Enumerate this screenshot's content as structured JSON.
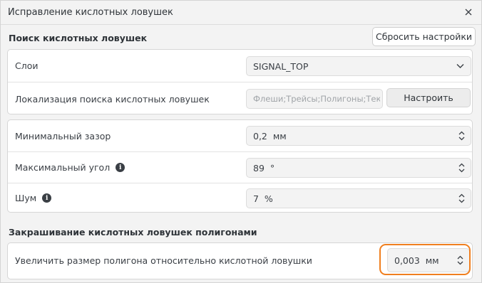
{
  "dialog": {
    "title": "Исправление кислотных ловушек",
    "close_icon": "close-icon"
  },
  "search_section": {
    "heading": "Поиск кислотных ловушек",
    "reset_label": "Сбросить настройки",
    "layers_label": "Слои",
    "layers_value": "SIGNAL_TOP",
    "localization_label": "Локализация поиска кислотных ловушек",
    "localization_value": "Флеши;Трейсы;Полигоны;Текс",
    "configure_label": "Настроить"
  },
  "params": {
    "min_gap_label": "Минимальный зазор",
    "min_gap_value": "0,2",
    "min_gap_unit": "мм",
    "max_angle_label": "Максимальный угол",
    "max_angle_value": "89",
    "max_angle_unit": "°",
    "noise_label": "Шум",
    "noise_value": "7",
    "noise_unit": "%"
  },
  "fill_section": {
    "heading": "Закрашивание кислотных ловушек полигонами",
    "enlarge_label": "Увеличить размер полигона относительно кислотной ловушки",
    "enlarge_value": "0,003",
    "enlarge_unit": "мм"
  },
  "colors": {
    "highlight": "#f07f1f",
    "panel_bg": "#ffffff",
    "dialog_bg": "#f3f3f3"
  }
}
